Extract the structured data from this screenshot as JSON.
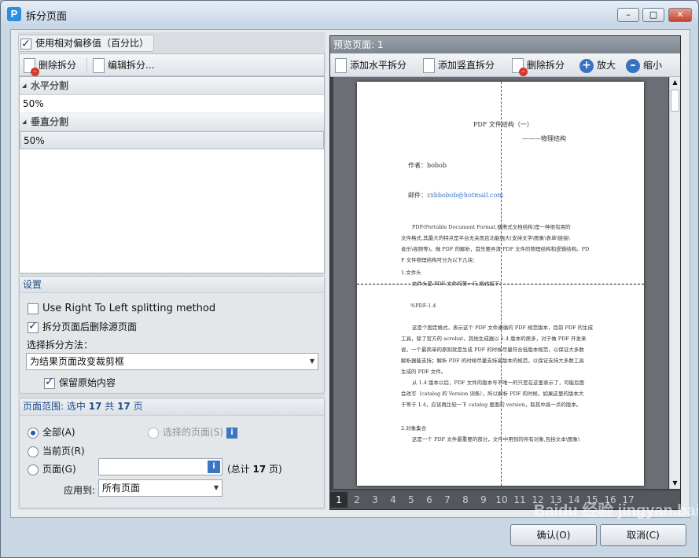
{
  "window": {
    "title": "拆分页面",
    "app_icon_letter": "P",
    "buttons": {
      "minimize": "–",
      "maximize": "□",
      "close": "✕"
    }
  },
  "left": {
    "relative_offset_label": "使用相对偏移值（百分比）",
    "relative_offset_checked": true,
    "toolbar": {
      "delete_split": "删除拆分",
      "edit_split": "编辑拆分..."
    },
    "list": {
      "horizontal_header": "水平分割",
      "horizontal_value": "50%",
      "vertical_header": "垂直分割",
      "vertical_value": "50%"
    },
    "settings": {
      "title": "设置",
      "rtl_label": "Use Right To Left splitting method",
      "rtl_checked": false,
      "delete_source_label": "拆分页面后删除源页面",
      "delete_source_checked": true,
      "method_label": "选择拆分方法：",
      "method_value": "为结果页面改变裁剪框",
      "keep_content_label": "保留原始内容",
      "keep_content_checked": true
    },
    "range": {
      "title_prefix": "页面范围: 选中",
      "selected": "17",
      "title_mid": "共",
      "total": "17",
      "title_suffix": "页",
      "all_label": "全部(A)",
      "selected_pages_label": "选择的页面(S)",
      "current_label": "当前页(R)",
      "pages_label": "页面(G)",
      "pages_value": "",
      "total_prefix": "(总计",
      "total_count": "17",
      "total_suffix": "页)",
      "apply_label": "应用到:",
      "apply_value": "所有页面",
      "selected_option": "all"
    }
  },
  "preview": {
    "header_prefix": "预览页面:",
    "header_page": "1",
    "toolbar": {
      "add_horizontal": "添加水平拆分",
      "add_vertical": "添加竖直拆分",
      "delete_split": "删除拆分",
      "zoom_in": "放大",
      "zoom_out": "缩小"
    },
    "document": {
      "title": "PDF 文件结构（一）",
      "subtitle": "———物理结构",
      "author": "作者：bobob",
      "email_label": "邮件：",
      "email": "zxbbobob@hotmail.com",
      "lines": [
        "PDF(Portable    Document    Format,便携式文档结构)是一种很有用的",
        "文件格式,其最大的特点是平台无关而且功能强大(支持文字\\图象\\表单\\链接\\",
        "音乐\\视频等)。做 PDF 的解析，首先要弄清 PDF 文件的物理结构和逻辑结构。PD",
        "F 文件物理结构可分为以下几块：",
        "1.文件头",
        "文件头是 PDF 文件的第一行,格式如下：",
        "%PDF-1.4",
        "这是个固定格式，表示这个 PDF 文件遵循的 PDF 规范版本，目前 PDF 的生成",
        "工具，除了官方的 acrobat，其他生成器以 1.4 版本的居多，对于做 PDF 开发来",
        "说，一个最简单的原则就是生成 PDF 的时候尽量符合低版本规范，以保证大多数",
        "解析器能支持；解析 PDF 的时候尽量支持高版本的规范，以保证支持大多数工具",
        "生成的 PDF 文件。",
        "从 1.4 版本以后，PDF 文件的版本号不唯一的只是在这里表示了，可能后面",
        "会改写（catalog 的 Version 词条），所以解析 PDF 的时候，如果这里的版本大",
        "于等于 1.4，应该再比较一下 catalog 里面的 version，取其中高一点的版本。",
        "2.对象集合",
        "这是一个 PDF 文件最重要的部分，文件中用到的所有对象,包括文本\\图象\\"
      ]
    },
    "split": {
      "horizontal_percent": 50,
      "vertical_percent": 50
    },
    "pages": [
      "1",
      "2",
      "3",
      "4",
      "5",
      "6",
      "7",
      "8",
      "9",
      "10",
      "11",
      "12",
      "13",
      "14",
      "15",
      "16",
      "17"
    ],
    "current_page": "1"
  },
  "footer": {
    "ok": "确认(O)",
    "cancel": "取消(C)"
  },
  "watermark": "Baidu 经验 jingyan.baidu.com",
  "colors": {
    "accent": "#2b8fe0",
    "split_line": "#c0262c",
    "pager_bg": "#54585e"
  }
}
